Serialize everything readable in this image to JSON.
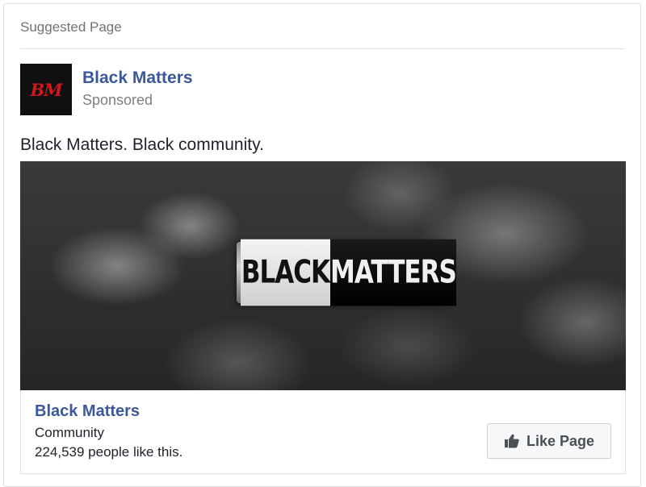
{
  "header": {
    "label": "Suggested Page"
  },
  "page": {
    "avatar_text": "BM",
    "name": "Black Matters",
    "sponsored_label": "Sponsored"
  },
  "post": {
    "text": "Black Matters. Black community."
  },
  "cover": {
    "logo_left": "BLACK",
    "logo_right": "MATTERS"
  },
  "footer": {
    "name": "Black Matters",
    "category": "Community",
    "likes_text": "224,539 people like this.",
    "like_button_label": "Like Page",
    "like_button_icon": "thumbs-up-icon"
  },
  "colors": {
    "link": "#3b5998",
    "avatar_text": "#d0181c",
    "button_bg": "#f6f7f9"
  }
}
